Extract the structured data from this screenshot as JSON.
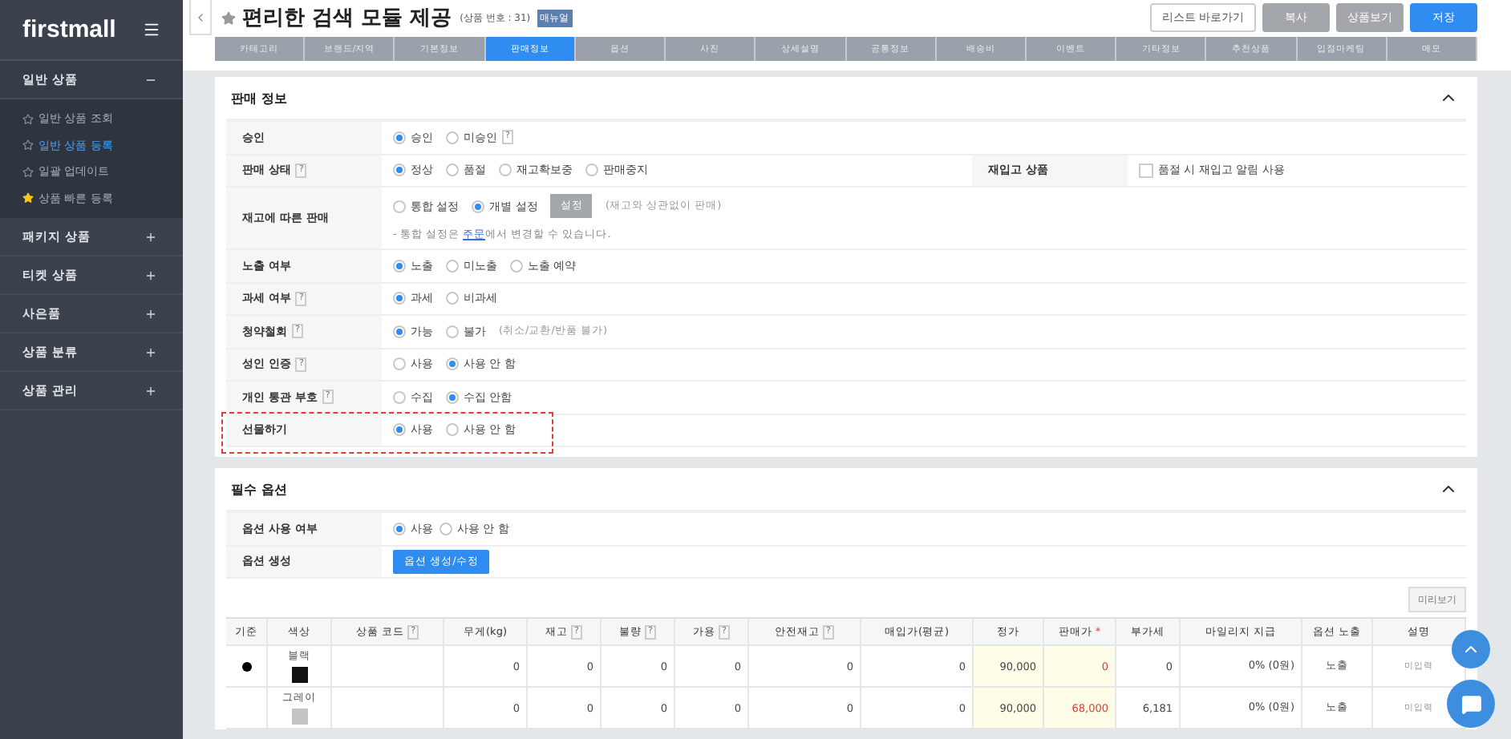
{
  "sidebar": {
    "logo": "firstmall",
    "groups": [
      {
        "label": "일반 상품",
        "expanded": true,
        "items": [
          {
            "label": "일반 상품 조회",
            "selected": false,
            "starred": false
          },
          {
            "label": "일반 상품 등록",
            "selected": true,
            "starred": false
          },
          {
            "label": "일괄 업데이트",
            "selected": false,
            "starred": false
          },
          {
            "label": "상품 빠른 등록",
            "selected": false,
            "starred": true
          }
        ]
      },
      {
        "label": "패키지 상품",
        "expanded": false
      },
      {
        "label": "티켓 상품",
        "expanded": false
      },
      {
        "label": "사은품",
        "expanded": false
      },
      {
        "label": "상품 분류",
        "expanded": false
      },
      {
        "label": "상품 관리",
        "expanded": false
      }
    ]
  },
  "header": {
    "title": "편리한 검색 모듈 제공",
    "product_no": "(상품 번호 : 31)",
    "badge": "매뉴얼",
    "buttons": [
      {
        "label": "리스트 바로가기",
        "kind": "outline"
      },
      {
        "label": "복사",
        "kind": "gray"
      },
      {
        "label": "상품보기",
        "kind": "gray"
      },
      {
        "label": "저장",
        "kind": "primary"
      }
    ]
  },
  "tabs": [
    {
      "label": "카테고리",
      "selected": false
    },
    {
      "label": "브랜드/지역",
      "selected": false
    },
    {
      "label": "기본정보",
      "selected": false
    },
    {
      "label": "판매정보",
      "selected": true
    },
    {
      "label": "옵션",
      "selected": false
    },
    {
      "label": "사진",
      "selected": false
    },
    {
      "label": "상세설명",
      "selected": false
    },
    {
      "label": "공통정보",
      "selected": false
    },
    {
      "label": "배송비",
      "selected": false
    },
    {
      "label": "이벤트",
      "selected": false
    },
    {
      "label": "기타정보",
      "selected": false
    },
    {
      "label": "추천상품",
      "selected": false
    },
    {
      "label": "입점마케팅",
      "selected": false
    },
    {
      "label": "메모",
      "selected": false
    }
  ],
  "sales_info": {
    "title": "판매 정보",
    "rows": [
      {
        "label": "승인",
        "highlighted": false,
        "options": [
          {
            "label": "승인",
            "selected": true
          },
          {
            "label": "미승인",
            "selected": false,
            "help": "?"
          }
        ]
      },
      {
        "label": "판매 상태",
        "help": "?",
        "highlighted": false,
        "options": [
          {
            "label": "정상",
            "selected": true
          },
          {
            "label": "품절",
            "selected": false
          },
          {
            "label": "재고확보중",
            "selected": false
          },
          {
            "label": "판매중지",
            "selected": false
          }
        ],
        "side": {
          "label": "재입고 상품",
          "checkbox": "품절 시 재입고 알림 사용",
          "checked": false
        }
      },
      {
        "label": "재고에 따른 판매",
        "highlighted": false,
        "options": [
          {
            "label": "통합 설정",
            "selected": false
          },
          {
            "label": "개별 설정",
            "selected": true
          }
        ],
        "button": "설정",
        "note": "(재고와 상관없이 판매)",
        "hint": [
          "- 통합 설정은 ",
          "주문",
          "에서 변경할 수 있습니다."
        ]
      },
      {
        "label": "노출 여부",
        "highlighted": false,
        "options": [
          {
            "label": "노출",
            "selected": true
          },
          {
            "label": "미노출",
            "selected": false
          },
          {
            "label": "노출 예약",
            "selected": false
          }
        ]
      },
      {
        "label": "과세 여부",
        "help": "?",
        "highlighted": false,
        "options": [
          {
            "label": "과세",
            "selected": true
          },
          {
            "label": "비과세",
            "selected": false
          }
        ]
      },
      {
        "label": "청약철회",
        "help": "?",
        "highlighted": false,
        "options": [
          {
            "label": "가능",
            "selected": true
          },
          {
            "label": "불가",
            "selected": false
          }
        ],
        "note": "(취소/교환/반품 불가)"
      },
      {
        "label": "성인 인증",
        "help": "?",
        "highlighted": false,
        "options": [
          {
            "label": "사용",
            "selected": false
          },
          {
            "label": "사용 안 함",
            "selected": true
          }
        ]
      },
      {
        "label": "개인 통관 부호",
        "help": "?",
        "highlighted": false,
        "options": [
          {
            "label": "수집",
            "selected": false
          },
          {
            "label": "수집 안함",
            "selected": true
          }
        ]
      },
      {
        "label": "선물하기",
        "highlighted": true,
        "options": [
          {
            "label": "사용",
            "selected": true
          },
          {
            "label": "사용 안 함",
            "selected": false
          }
        ]
      }
    ]
  },
  "options": {
    "title": "필수 옵션",
    "use_label": "옵션 사용 여부",
    "use_options": [
      {
        "label": "사용",
        "selected": true
      },
      {
        "label": "사용 안 함",
        "selected": false
      }
    ],
    "create_label": "옵션 생성",
    "create_button": "옵션 생성/수정",
    "preview_button": "미리보기",
    "columns": [
      {
        "label": "기준"
      },
      {
        "label": "색상"
      },
      {
        "label": "상품 코드",
        "help": "?"
      },
      {
        "label": "무게(kg)"
      },
      {
        "label": "재고",
        "help": "?"
      },
      {
        "label": "불량",
        "help": "?"
      },
      {
        "label": "가용",
        "help": "?"
      },
      {
        "label": "안전재고",
        "help": "?"
      },
      {
        "label": "매입가(평균)"
      },
      {
        "label": "정가"
      },
      {
        "label": "판매가",
        "required": "*"
      },
      {
        "label": "부가세"
      },
      {
        "label": "마일리지 지급"
      },
      {
        "label": "옵션 노출"
      },
      {
        "label": "설명"
      }
    ],
    "rows": [
      {
        "default": true,
        "color_name": "블랙",
        "color": "#111111",
        "weight": "0",
        "stock": "0",
        "bad": "0",
        "available": "0",
        "safety": "0",
        "cost": "0",
        "list_price": "90,000",
        "price": "0",
        "vat": "0",
        "mileage": "0% (0원)",
        "display": "노출",
        "desc": "미입력"
      },
      {
        "default": false,
        "color_name": "그레이",
        "color": "#c4c4c4",
        "weight": "0",
        "stock": "0",
        "bad": "0",
        "available": "0",
        "safety": "0",
        "cost": "0",
        "list_price": "90,000",
        "price": "68,000",
        "vat": "6,181",
        "mileage": "0% (0원)",
        "display": "노출",
        "desc": "미입력"
      }
    ]
  }
}
